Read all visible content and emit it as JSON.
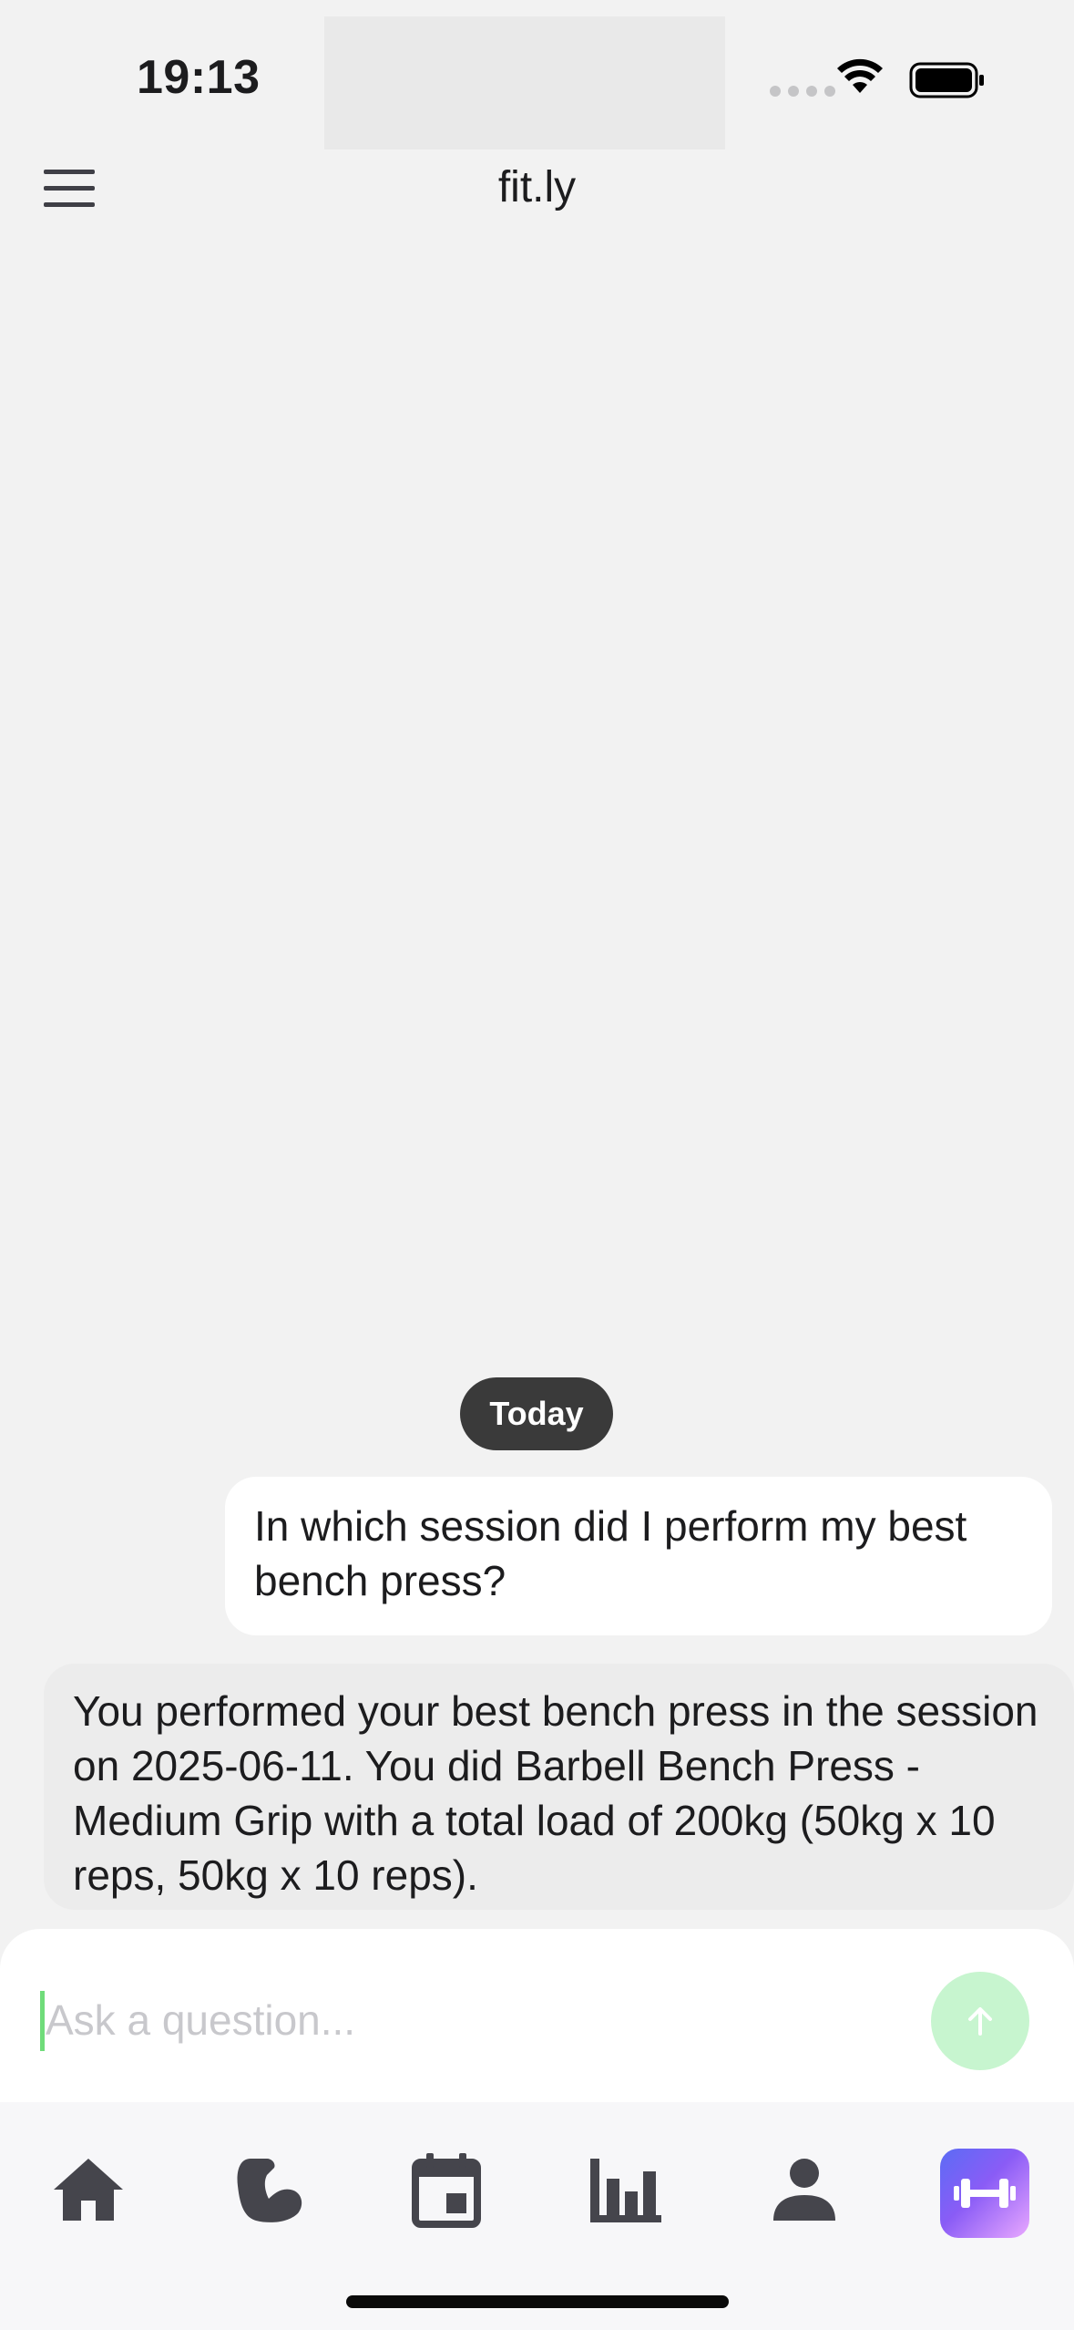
{
  "status_bar": {
    "time": "19:13"
  },
  "header": {
    "title": "fit.ly"
  },
  "chat": {
    "date_label": "Today",
    "messages": [
      {
        "role": "user",
        "text": "In which session did I perform my best bench press?"
      },
      {
        "role": "assistant",
        "text": "You performed your best bench press in the session on 2025-06-11. You did Barbell Bench Press - Medium Grip with a total load of 200kg (50kg x 10 reps, 50kg x 10 reps)."
      }
    ]
  },
  "composer": {
    "placeholder": "Ask a question...",
    "value": ""
  },
  "tab_bar": {
    "items": [
      {
        "icon": "home-icon"
      },
      {
        "icon": "muscle-icon"
      },
      {
        "icon": "calendar-icon"
      },
      {
        "icon": "bar-chart-icon"
      },
      {
        "icon": "person-icon"
      },
      {
        "icon": "dumbbell-icon",
        "active": true
      }
    ]
  },
  "colors": {
    "accent": "#6fdc7a",
    "send_button": "#c7f5cf",
    "date_chip": "#3a3a3a",
    "icon": "#45454c"
  }
}
